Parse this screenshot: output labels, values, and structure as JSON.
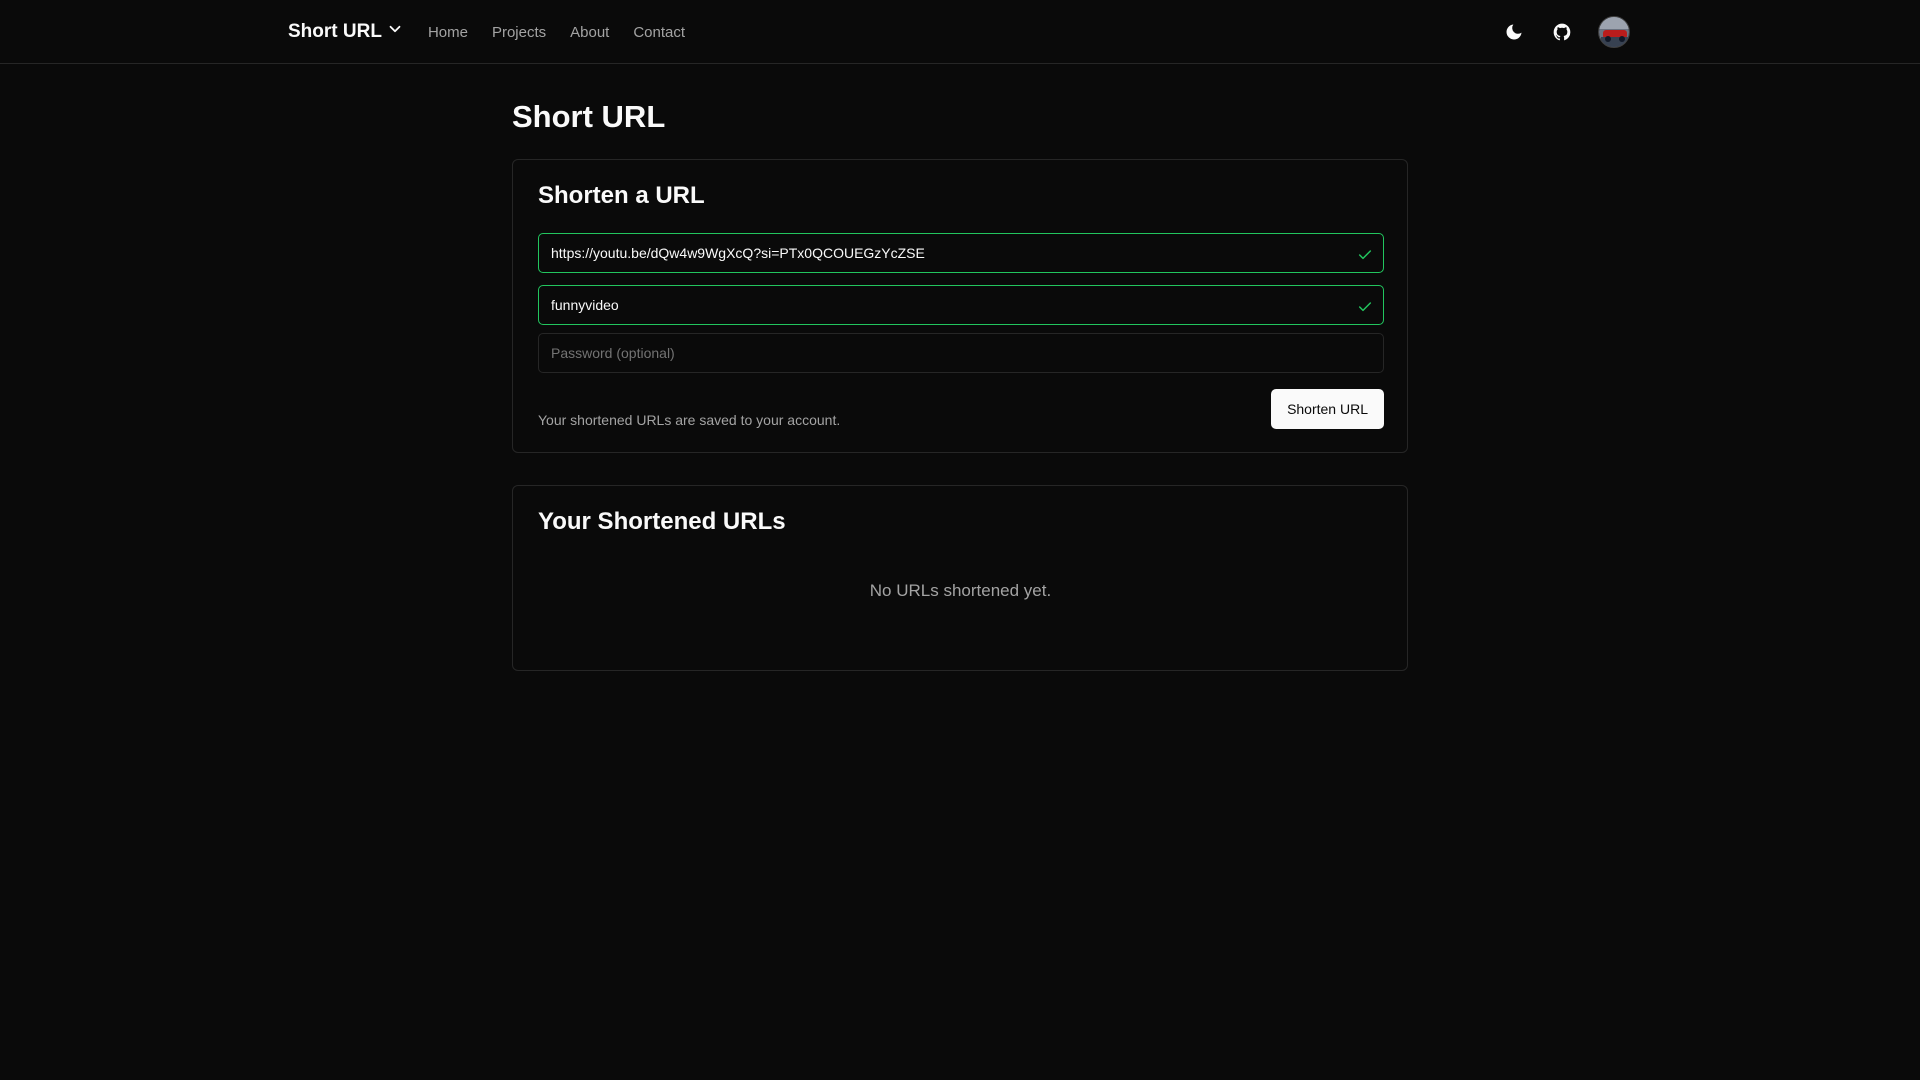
{
  "nav": {
    "brand": "Short URL",
    "links": [
      "Home",
      "Projects",
      "About",
      "Contact"
    ],
    "theme_icon": "moon-icon",
    "github_icon": "github-icon"
  },
  "page": {
    "title": "Short URL"
  },
  "form": {
    "title": "Shorten a URL",
    "url_value": "https://youtu.be/dQw4w9WgXcQ?si=PTx0QCOUEGzYcZSE",
    "alias_value": "funnyvideo",
    "password_placeholder": "Password (optional)",
    "hint": "Your shortened URLs are saved to your account.",
    "submit_label": "Shorten URL"
  },
  "list": {
    "title": "Your Shortened URLs",
    "empty_message": "No URLs shortened yet."
  },
  "colors": {
    "background": "#0a0a0a",
    "border": "#262626",
    "valid": "#22c55e",
    "muted_text": "#a3a3a3"
  }
}
